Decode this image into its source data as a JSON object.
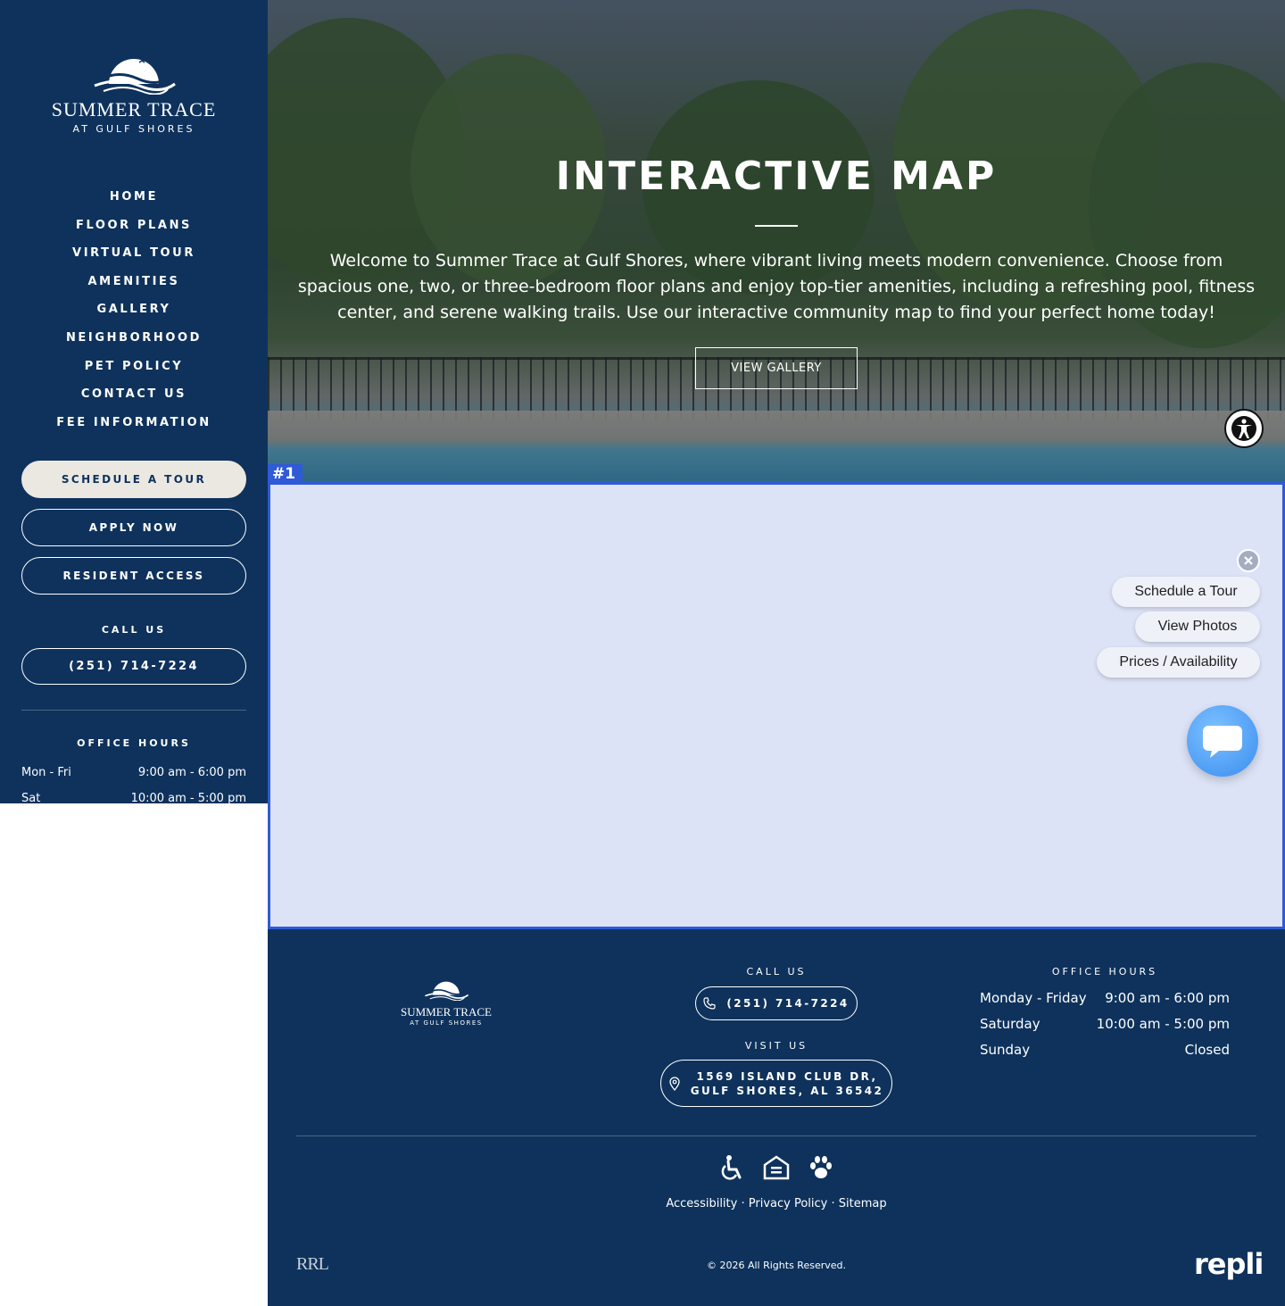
{
  "brand": {
    "name": "SUMMER TRACE",
    "location": "AT GULF SHORES",
    "footer_name": "SUMMER TRACE",
    "footer_location": "AT GULF SHORES"
  },
  "sidebar": {
    "nav": [
      "HOME",
      "FLOOR PLANS",
      "VIRTUAL TOUR",
      "AMENITIES",
      "GALLERY",
      "NEIGHBORHOOD",
      "PET POLICY",
      "CONTACT US",
      "FEE INFORMATION"
    ],
    "schedule_tour": "SCHEDULE A TOUR",
    "apply_now": "APPLY NOW",
    "resident_access": "RESIDENT ACCESS",
    "call_label": "CALL US",
    "phone": "(251) 714-7224",
    "hours_label": "OFFICE HOURS",
    "hours": [
      {
        "day": "Mon - Fri",
        "time": "9:00 am - 6:00 pm"
      },
      {
        "day": "Sat",
        "time": "10:00 am - 5:00 pm"
      }
    ]
  },
  "hero": {
    "title": "INTERACTIVE MAP",
    "description": "Welcome to Summer Trace at Gulf Shores, where vibrant living meets modern convenience. Choose from spacious one, two, or three-bedroom floor plans and enjoy top-tier amenities, including a refreshing pool, fitness center, and serene walking trails. Use our interactive community map to find your perfect home today!",
    "button": "VIEW GALLERY"
  },
  "map": {
    "tag": "#1",
    "chips": [
      "Schedule a Tour",
      "View Photos",
      "Prices / Availability"
    ]
  },
  "footer": {
    "call_label": "CALL US",
    "phone": "(251) 714-7224",
    "visit_label": "VISIT US",
    "address_line1": "1569 ISLAND CLUB DR,",
    "address_line2": "GULF SHORES, AL 36542",
    "hours_label": "OFFICE HOURS",
    "hours": [
      {
        "day": "Monday - Friday",
        "time": "9:00 am - 6:00 pm"
      },
      {
        "day": "Saturday",
        "time": "10:00 am - 5:00 pm"
      },
      {
        "day": "Sunday",
        "time": "Closed"
      }
    ],
    "links": [
      "Accessibility",
      "Privacy Policy",
      "Sitemap"
    ],
    "separator": "·",
    "copyright": "© 2026 All Rights Reserved.",
    "rrl_logo": "RRL",
    "repli_logo": "repli"
  },
  "colors": {
    "navy": "#0e325c",
    "cream": "#ebe8e2",
    "highlight_blue": "#2f5ad8",
    "map_fill": "#dde3f7",
    "chat_blue": "#3a8ef0",
    "repli_dot": "#e2407e"
  },
  "icons": [
    "logo-sun-wave-icon",
    "accessibility-person-icon",
    "close-icon",
    "chat-bubble-icon",
    "phone-icon",
    "map-pin-icon",
    "wheelchair-icon",
    "equal-housing-icon",
    "paw-icon"
  ]
}
